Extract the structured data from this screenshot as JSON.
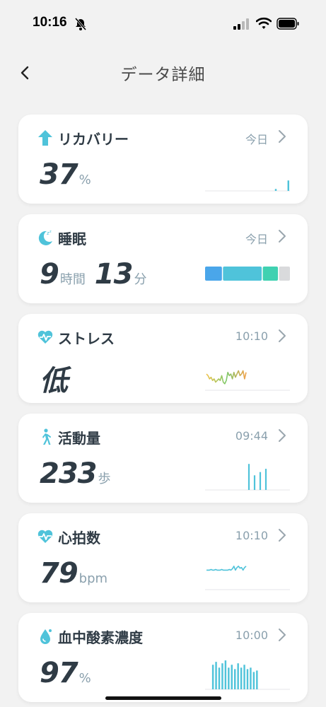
{
  "status_bar": {
    "time": "10:16"
  },
  "nav": {
    "title": "データ詳細"
  },
  "colors": {
    "accent": "#4fc3da",
    "sleep_deep": "#4aa6ea",
    "sleep_light": "#4fc3da",
    "sleep_rem": "#3fd1b1",
    "sleep_awake": "#d9dadc",
    "text_dark": "#2f3b45",
    "text_muted": "#8aa0ad"
  },
  "cards": [
    {
      "id": "recovery",
      "icon": "up-arrow-icon",
      "title": "リカバリー",
      "time": "今日",
      "value": "37",
      "unit": "%"
    },
    {
      "id": "sleep",
      "icon": "moon-icon",
      "title": "睡眠",
      "time": "今日",
      "value_hours": "9",
      "unit_hours": "時間",
      "value_minutes": "13",
      "unit_minutes": "分",
      "stages": [
        {
          "name": "deep",
          "fraction": 0.2
        },
        {
          "name": "light",
          "fraction": 0.46
        },
        {
          "name": "rem",
          "fraction": 0.18
        },
        {
          "name": "awake",
          "fraction": 0.13
        }
      ]
    },
    {
      "id": "stress",
      "icon": "heart-pulse-icon",
      "title": "ストレス",
      "time": "10:10",
      "value": "低"
    },
    {
      "id": "activity",
      "icon": "walking-icon",
      "title": "活動量",
      "time": "09:44",
      "value": "233",
      "unit": "歩"
    },
    {
      "id": "heart_rate",
      "icon": "heart-rate-icon",
      "title": "心拍数",
      "time": "10:10",
      "value": "79",
      "unit": "bpm"
    },
    {
      "id": "spo2",
      "icon": "water-drop-icon",
      "title": "血中酸素濃度",
      "time": "10:00",
      "value": "97",
      "unit": "%"
    }
  ],
  "chart_data": [
    {
      "type": "bar",
      "card": "recovery",
      "values": [
        0,
        0,
        0,
        0,
        0,
        0,
        0,
        0,
        0,
        0,
        0,
        0,
        0,
        0,
        0,
        0,
        0,
        0,
        0,
        0,
        0,
        0,
        3,
        0,
        0,
        0,
        16
      ],
      "ylim": [
        0,
        50
      ]
    },
    {
      "type": "line",
      "card": "stress",
      "values": [
        20,
        18,
        14,
        16,
        12,
        14,
        10,
        12,
        14,
        12,
        18,
        10,
        8,
        12,
        22,
        18,
        20,
        14,
        22,
        16,
        20,
        24,
        18,
        20,
        24,
        14,
        22
      ],
      "ylim": [
        0,
        40
      ]
    },
    {
      "type": "bar",
      "card": "activity",
      "values": [
        0,
        0,
        0,
        0,
        0,
        0,
        0,
        0,
        0,
        0,
        0,
        0,
        0,
        0,
        0,
        32,
        0,
        18,
        0,
        22,
        0,
        26,
        0,
        0,
        0,
        0,
        0,
        0,
        0,
        0
      ],
      "ylim": [
        0,
        40
      ]
    },
    {
      "type": "line",
      "card": "heart_rate",
      "values": [
        30,
        30,
        30,
        31,
        30,
        30,
        31,
        30,
        30,
        30,
        31,
        30,
        30,
        30,
        30,
        31,
        30,
        32,
        36,
        30,
        34,
        36,
        33,
        34,
        30,
        34,
        36
      ],
      "ylim": [
        0,
        50
      ]
    },
    {
      "type": "bar",
      "card": "spo2",
      "values": [
        0,
        0,
        34,
        38,
        30,
        36,
        40,
        30,
        34,
        28,
        36,
        30,
        34,
        28,
        30,
        24,
        26,
        0,
        0,
        0,
        0,
        0,
        0,
        0,
        0,
        0,
        0
      ],
      "ylim": [
        0,
        45
      ]
    }
  ]
}
